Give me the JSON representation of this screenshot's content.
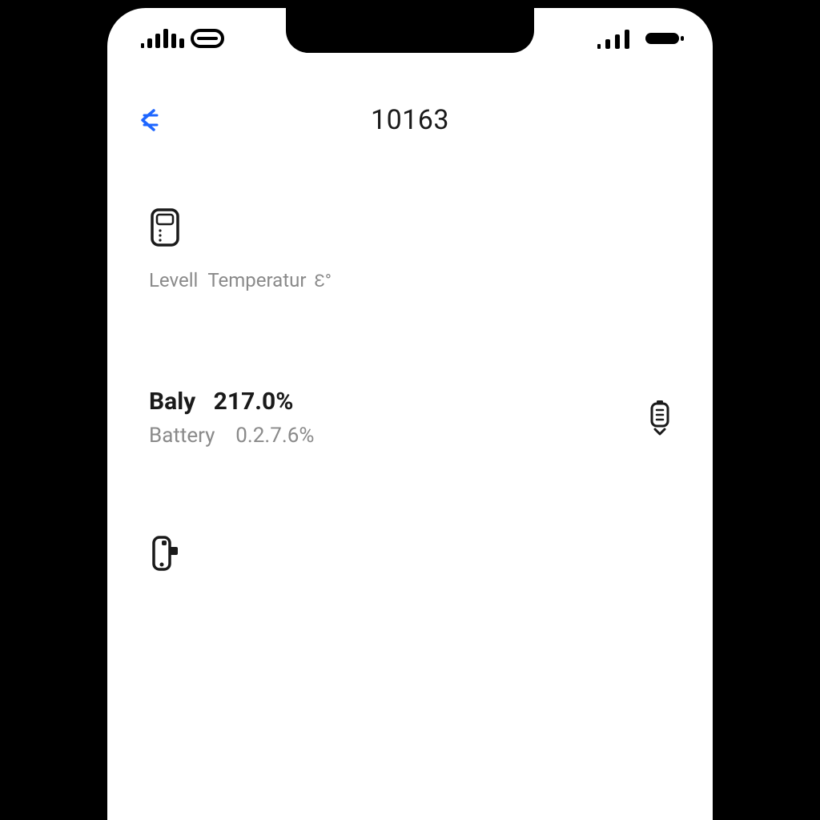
{
  "status_bar": {
    "left_carrier_glyph": "ııllıı⊟",
    "right_signal_glyph": "ııll"
  },
  "header": {
    "title": "10163"
  },
  "section_level": {
    "level_label": "Levell",
    "temperature_label": "Temperatur",
    "temperature_unit": "Ɛ°"
  },
  "section_battery": {
    "primary_label": "Baly",
    "primary_value": "217.0%",
    "secondary_label": "Battery",
    "secondary_value": "0.2.7.6%"
  },
  "icons": {
    "device_icon": "device-icon",
    "battery_right_icon": "battery-down-icon",
    "phone_icon": "phone-icon"
  },
  "colors": {
    "accent": "#1e66ff",
    "text_primary": "#1a1a1a",
    "text_secondary": "#8a8a8a",
    "bg": "#ffffff",
    "frame": "#000000"
  }
}
